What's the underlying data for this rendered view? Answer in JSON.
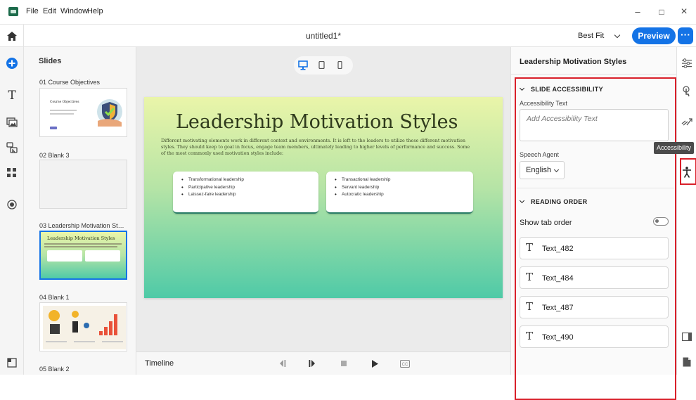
{
  "menu": {
    "items": [
      "File",
      "Edit",
      "Window",
      "Help"
    ]
  },
  "window_controls": {
    "minimize": "–",
    "maximize": "□",
    "close": "×"
  },
  "toolbar": {
    "doc_title": "untitled1*",
    "zoom": "Best Fit",
    "preview_label": "Preview",
    "more_label": "···"
  },
  "slides_panel": {
    "heading": "Slides",
    "slides": [
      {
        "label": "01 Course Objectives",
        "thumb_title": "Course Objectives"
      },
      {
        "label": "02 Blank 3"
      },
      {
        "label": "03 Leadership Motivation Styl...",
        "thumb_title": "Leadership Motivation Styles",
        "selected": true
      },
      {
        "label": "04 Blank 1"
      },
      {
        "label": "05 Blank 2"
      }
    ]
  },
  "slide": {
    "title": "Leadership Motivation Styles",
    "body": "Different motivating elements work in different context and environments. It is left to the leaders to utilize these different motivation styles. They should keep to goal in focus, engage team members, ultimately leading to higher levels of performance and success. Some of the most commonly used motivation styles include:",
    "left_list": [
      "Transformational leadership",
      "Participative leadership",
      "Laissez-faire leadership"
    ],
    "right_list": [
      "Transactional leadership",
      "Servant leadership",
      "Autocratic leadership"
    ]
  },
  "timeline": {
    "label": "Timeline"
  },
  "properties": {
    "title": "Leadership Motivation Styles",
    "slide_accessibility": {
      "heading": "SLIDE ACCESSIBILITY",
      "accessibility_text_label": "Accessibility Text",
      "accessibility_text_placeholder": "Add Accessibility Text",
      "speech_agent_label": "Speech Agent",
      "speech_agent_value": "English"
    },
    "reading_order": {
      "heading": "READING ORDER",
      "show_tab_order_label": "Show tab order",
      "show_tab_order": false,
      "items": [
        "Text_482",
        "Text_484",
        "Text_487",
        "Text_490"
      ]
    }
  },
  "right_rail": {
    "tooltip": "Accessibility"
  },
  "colors": {
    "accent": "#1473e6",
    "highlight": "#d9202a",
    "slide_gradient_top": "#eaf5a9",
    "slide_gradient_bottom": "#4fcaa7"
  }
}
